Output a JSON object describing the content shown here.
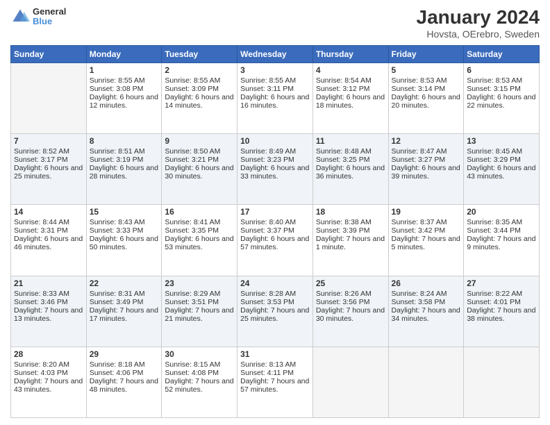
{
  "logo": {
    "line1": "General",
    "line2": "Blue"
  },
  "title": "January 2024",
  "subtitle": "Hovsta, OErebro, Sweden",
  "days": [
    "Sunday",
    "Monday",
    "Tuesday",
    "Wednesday",
    "Thursday",
    "Friday",
    "Saturday"
  ],
  "weeks": [
    [
      {
        "day": "",
        "empty": true
      },
      {
        "day": "1",
        "sunrise": "Sunrise: 8:55 AM",
        "sunset": "Sunset: 3:08 PM",
        "daylight": "Daylight: 6 hours and 12 minutes."
      },
      {
        "day": "2",
        "sunrise": "Sunrise: 8:55 AM",
        "sunset": "Sunset: 3:09 PM",
        "daylight": "Daylight: 6 hours and 14 minutes."
      },
      {
        "day": "3",
        "sunrise": "Sunrise: 8:55 AM",
        "sunset": "Sunset: 3:11 PM",
        "daylight": "Daylight: 6 hours and 16 minutes."
      },
      {
        "day": "4",
        "sunrise": "Sunrise: 8:54 AM",
        "sunset": "Sunset: 3:12 PM",
        "daylight": "Daylight: 6 hours and 18 minutes."
      },
      {
        "day": "5",
        "sunrise": "Sunrise: 8:53 AM",
        "sunset": "Sunset: 3:14 PM",
        "daylight": "Daylight: 6 hours and 20 minutes."
      },
      {
        "day": "6",
        "sunrise": "Sunrise: 8:53 AM",
        "sunset": "Sunset: 3:15 PM",
        "daylight": "Daylight: 6 hours and 22 minutes."
      }
    ],
    [
      {
        "day": "7",
        "sunrise": "Sunrise: 8:52 AM",
        "sunset": "Sunset: 3:17 PM",
        "daylight": "Daylight: 6 hours and 25 minutes."
      },
      {
        "day": "8",
        "sunrise": "Sunrise: 8:51 AM",
        "sunset": "Sunset: 3:19 PM",
        "daylight": "Daylight: 6 hours and 28 minutes."
      },
      {
        "day": "9",
        "sunrise": "Sunrise: 8:50 AM",
        "sunset": "Sunset: 3:21 PM",
        "daylight": "Daylight: 6 hours and 30 minutes."
      },
      {
        "day": "10",
        "sunrise": "Sunrise: 8:49 AM",
        "sunset": "Sunset: 3:23 PM",
        "daylight": "Daylight: 6 hours and 33 minutes."
      },
      {
        "day": "11",
        "sunrise": "Sunrise: 8:48 AM",
        "sunset": "Sunset: 3:25 PM",
        "daylight": "Daylight: 6 hours and 36 minutes."
      },
      {
        "day": "12",
        "sunrise": "Sunrise: 8:47 AM",
        "sunset": "Sunset: 3:27 PM",
        "daylight": "Daylight: 6 hours and 39 minutes."
      },
      {
        "day": "13",
        "sunrise": "Sunrise: 8:45 AM",
        "sunset": "Sunset: 3:29 PM",
        "daylight": "Daylight: 6 hours and 43 minutes."
      }
    ],
    [
      {
        "day": "14",
        "sunrise": "Sunrise: 8:44 AM",
        "sunset": "Sunset: 3:31 PM",
        "daylight": "Daylight: 6 hours and 46 minutes."
      },
      {
        "day": "15",
        "sunrise": "Sunrise: 8:43 AM",
        "sunset": "Sunset: 3:33 PM",
        "daylight": "Daylight: 6 hours and 50 minutes."
      },
      {
        "day": "16",
        "sunrise": "Sunrise: 8:41 AM",
        "sunset": "Sunset: 3:35 PM",
        "daylight": "Daylight: 6 hours and 53 minutes."
      },
      {
        "day": "17",
        "sunrise": "Sunrise: 8:40 AM",
        "sunset": "Sunset: 3:37 PM",
        "daylight": "Daylight: 6 hours and 57 minutes."
      },
      {
        "day": "18",
        "sunrise": "Sunrise: 8:38 AM",
        "sunset": "Sunset: 3:39 PM",
        "daylight": "Daylight: 7 hours and 1 minute."
      },
      {
        "day": "19",
        "sunrise": "Sunrise: 8:37 AM",
        "sunset": "Sunset: 3:42 PM",
        "daylight": "Daylight: 7 hours and 5 minutes."
      },
      {
        "day": "20",
        "sunrise": "Sunrise: 8:35 AM",
        "sunset": "Sunset: 3:44 PM",
        "daylight": "Daylight: 7 hours and 9 minutes."
      }
    ],
    [
      {
        "day": "21",
        "sunrise": "Sunrise: 8:33 AM",
        "sunset": "Sunset: 3:46 PM",
        "daylight": "Daylight: 7 hours and 13 minutes."
      },
      {
        "day": "22",
        "sunrise": "Sunrise: 8:31 AM",
        "sunset": "Sunset: 3:49 PM",
        "daylight": "Daylight: 7 hours and 17 minutes."
      },
      {
        "day": "23",
        "sunrise": "Sunrise: 8:29 AM",
        "sunset": "Sunset: 3:51 PM",
        "daylight": "Daylight: 7 hours and 21 minutes."
      },
      {
        "day": "24",
        "sunrise": "Sunrise: 8:28 AM",
        "sunset": "Sunset: 3:53 PM",
        "daylight": "Daylight: 7 hours and 25 minutes."
      },
      {
        "day": "25",
        "sunrise": "Sunrise: 8:26 AM",
        "sunset": "Sunset: 3:56 PM",
        "daylight": "Daylight: 7 hours and 30 minutes."
      },
      {
        "day": "26",
        "sunrise": "Sunrise: 8:24 AM",
        "sunset": "Sunset: 3:58 PM",
        "daylight": "Daylight: 7 hours and 34 minutes."
      },
      {
        "day": "27",
        "sunrise": "Sunrise: 8:22 AM",
        "sunset": "Sunset: 4:01 PM",
        "daylight": "Daylight: 7 hours and 38 minutes."
      }
    ],
    [
      {
        "day": "28",
        "sunrise": "Sunrise: 8:20 AM",
        "sunset": "Sunset: 4:03 PM",
        "daylight": "Daylight: 7 hours and 43 minutes."
      },
      {
        "day": "29",
        "sunrise": "Sunrise: 8:18 AM",
        "sunset": "Sunset: 4:06 PM",
        "daylight": "Daylight: 7 hours and 48 minutes."
      },
      {
        "day": "30",
        "sunrise": "Sunrise: 8:15 AM",
        "sunset": "Sunset: 4:08 PM",
        "daylight": "Daylight: 7 hours and 52 minutes."
      },
      {
        "day": "31",
        "sunrise": "Sunrise: 8:13 AM",
        "sunset": "Sunset: 4:11 PM",
        "daylight": "Daylight: 7 hours and 57 minutes."
      },
      {
        "day": "",
        "empty": true
      },
      {
        "day": "",
        "empty": true
      },
      {
        "day": "",
        "empty": true
      }
    ]
  ]
}
